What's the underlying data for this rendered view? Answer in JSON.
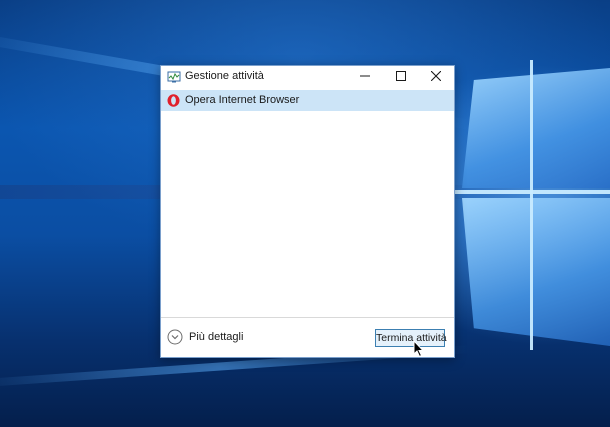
{
  "window": {
    "title": "Gestione attività",
    "icon": "task-manager-icon",
    "controls": {
      "minimize_icon": "minimize-icon",
      "maximize_icon": "maximize-icon",
      "close_icon": "close-icon"
    }
  },
  "processes": [
    {
      "name": "Opera Internet Browser",
      "icon": "opera-icon",
      "selected": true
    }
  ],
  "footer": {
    "details_label": "Più dettagli",
    "details_icon": "chevron-down-circle-icon",
    "end_task_label": "Termina attività"
  },
  "colors": {
    "selection": "#cce4f7",
    "button_border": "#3c7fb1",
    "button_fill": "#e5f1fb",
    "opera_red": "#e0202c",
    "desktop_blue": "#0b56b0"
  }
}
